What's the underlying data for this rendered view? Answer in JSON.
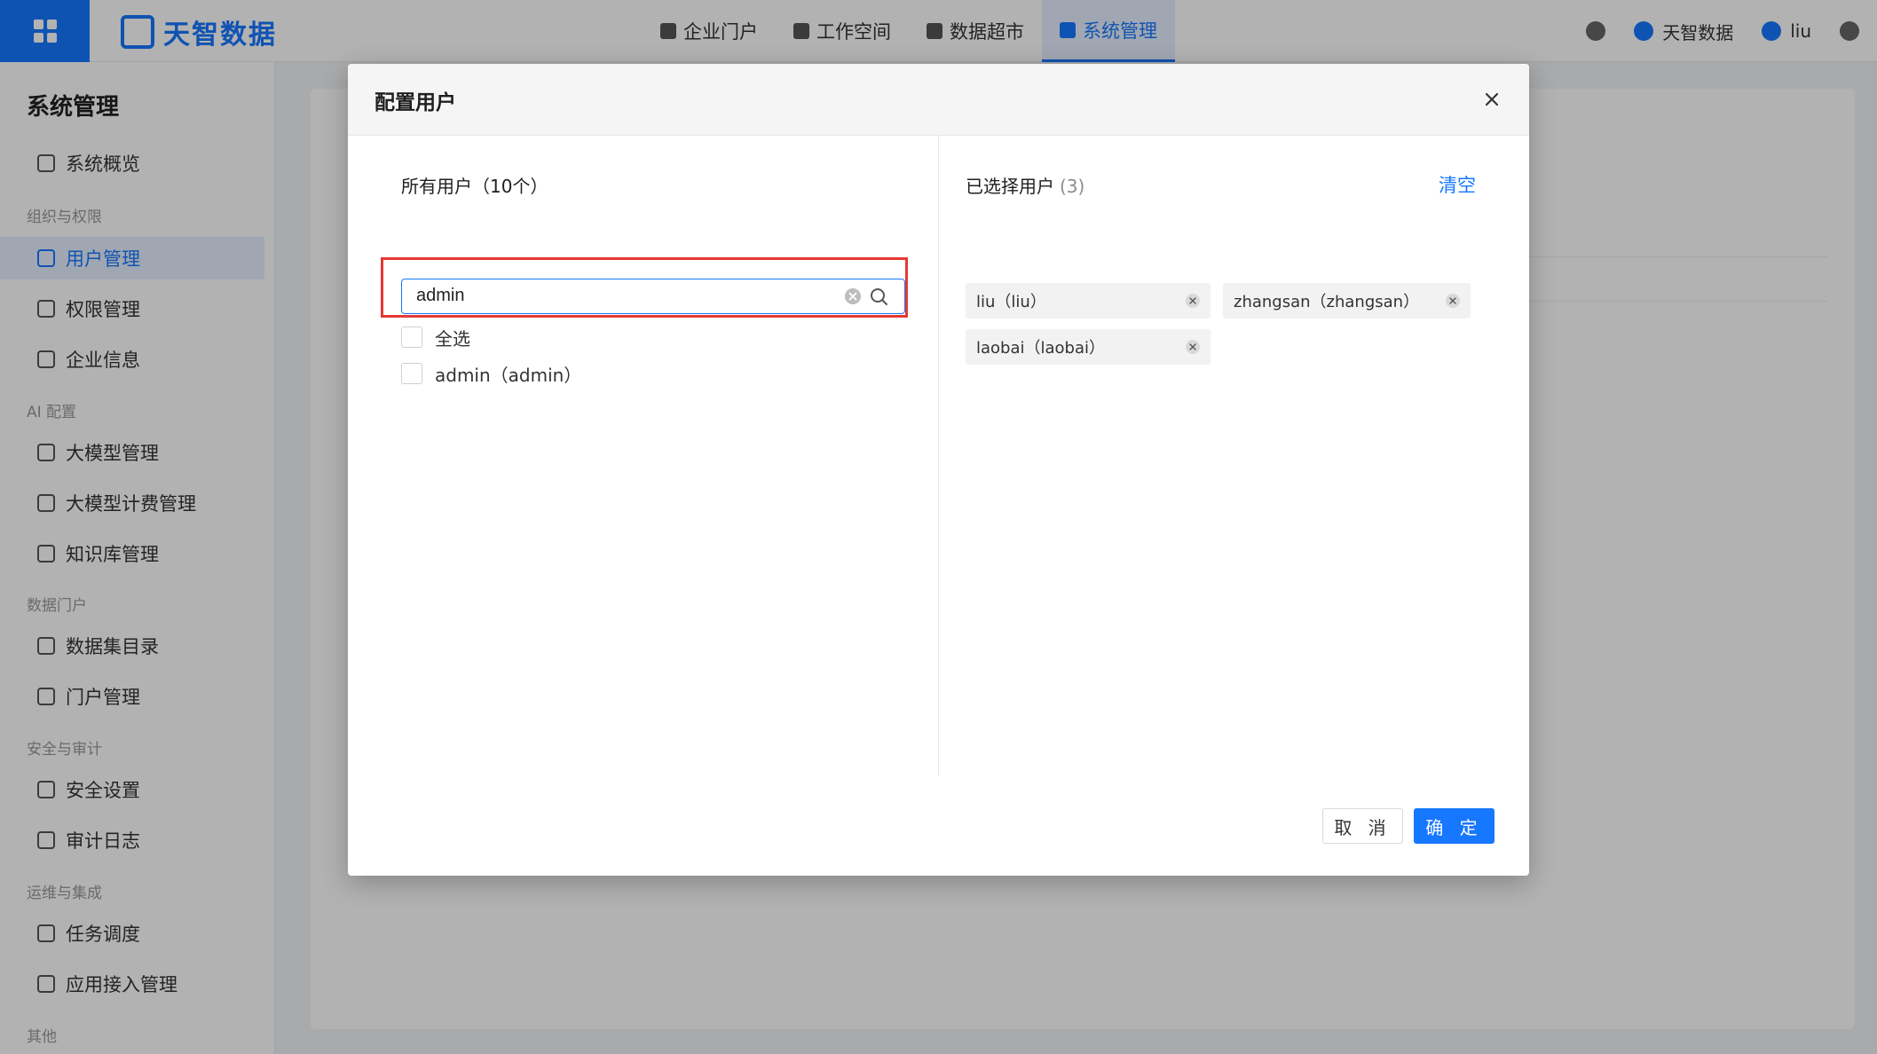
{
  "app": {
    "brand": "天智数据",
    "nav": [
      {
        "label": "企业门户"
      },
      {
        "label": "工作空间"
      },
      {
        "label": "数据超市"
      },
      {
        "label": "系统管理"
      }
    ],
    "user_menu": {
      "workspace": "天智数据",
      "user": "liu"
    },
    "sidebar": {
      "title": "系统管理",
      "groups": [
        {
          "label": "组织与权限"
        },
        {
          "label": "AI 配置"
        },
        {
          "label": "数据门户"
        },
        {
          "label": "安全与审计"
        },
        {
          "label": "运维与集成"
        },
        {
          "label": "其他"
        }
      ],
      "items": [
        {
          "label": "系统概览"
        },
        {
          "label": "用户管理"
        },
        {
          "label": "权限管理"
        },
        {
          "label": "企业信息"
        },
        {
          "label": "大模型管理"
        },
        {
          "label": "大模型计费管理"
        },
        {
          "label": "知识库管理"
        },
        {
          "label": "数据集目录"
        },
        {
          "label": "门户管理"
        },
        {
          "label": "安全设置"
        },
        {
          "label": "审计日志"
        },
        {
          "label": "任务调度"
        },
        {
          "label": "应用接入管理"
        }
      ]
    }
  },
  "modal": {
    "title": "配置用户",
    "left": {
      "title": "所有用户（10个）",
      "search_value": "admin",
      "select_all_label": "全选",
      "users": [
        {
          "label": "admin（admin）",
          "checked": false
        }
      ]
    },
    "right": {
      "title": "已选择用户",
      "count": "(3)",
      "clear_label": "清空",
      "selected": [
        {
          "label": "liu（liu）"
        },
        {
          "label": "zhangsan（zhangsan）"
        },
        {
          "label": "laobai（laobai）"
        }
      ]
    },
    "buttons": {
      "cancel": "取 消",
      "ok": "确 定"
    }
  },
  "colors": {
    "primary": "#1677ff",
    "highlight": "#e53935",
    "overlay": "rgba(0,0,0,0.30)"
  }
}
